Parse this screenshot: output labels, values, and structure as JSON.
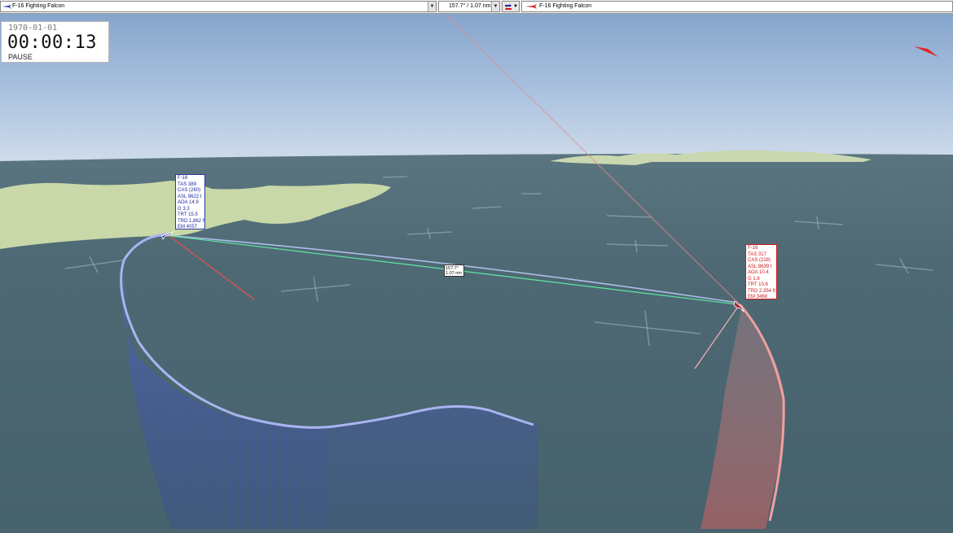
{
  "toolbar": {
    "left_aircraft": "F-16 Fighting Falcon",
    "measurement": "157.7° / 1.07 nm",
    "right_aircraft": "F-16 Fighting Falcon"
  },
  "clock": {
    "date": "1970-01-01",
    "time": "00:00:13",
    "state": "PAUSE"
  },
  "blue_aircraft": {
    "lines": [
      "F-16",
      "TAS 389",
      "CAS (260)",
      "ASL 9622 t",
      "AOA 14.9",
      "G 3.3",
      "TRT 15.5",
      "TRD 1,862 ft",
      "EM 4057"
    ]
  },
  "red_aircraft": {
    "lines": [
      "F-16",
      "TAS 317",
      "CAS (228)",
      "ASL 8639 t",
      "AOA 10.4",
      "G 1.8",
      "TRT 10.6",
      "TRD 2,354 ft",
      "EM 3468"
    ]
  },
  "range_label": {
    "bearing": "157.7°",
    "distance": "1.07 nm"
  },
  "colors": {
    "blue_team": "#1a2aa0",
    "red_team": "#d01818",
    "sea": "#4a6570",
    "land": "#c8d8a8",
    "sky": "#c4d6ec",
    "range_line": "#5ee8a0"
  }
}
